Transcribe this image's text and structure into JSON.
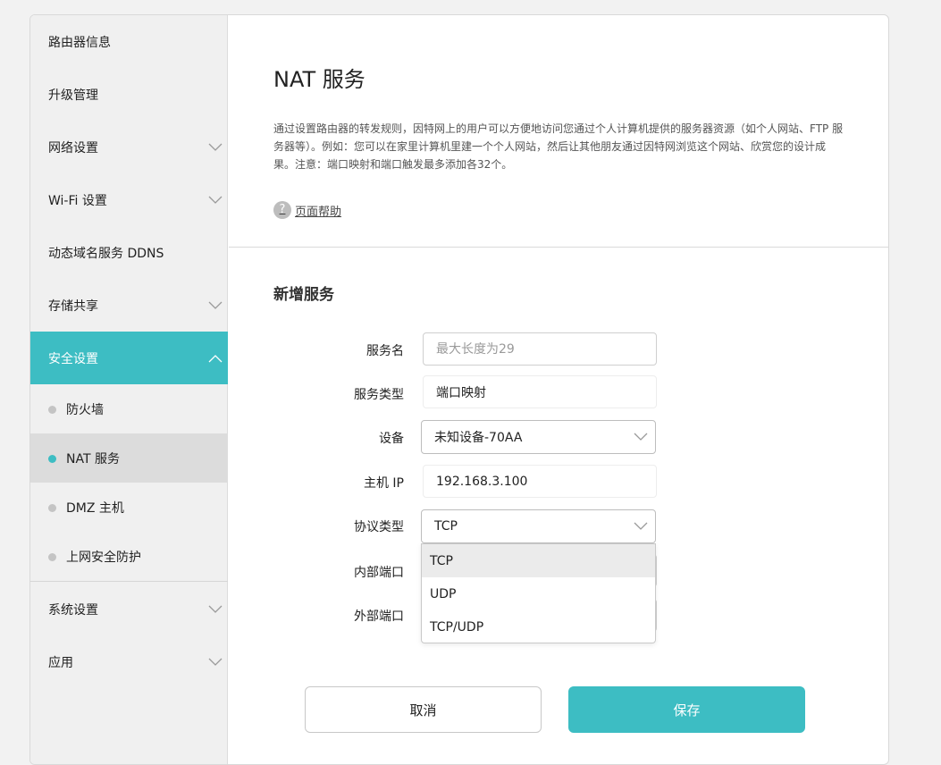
{
  "sidebar": {
    "items": [
      {
        "label": "路由器信息"
      },
      {
        "label": "升级管理"
      },
      {
        "label": "网络设置"
      },
      {
        "label": "Wi-Fi 设置"
      },
      {
        "label": "动态域名服务 DDNS"
      },
      {
        "label": "存储共享"
      },
      {
        "label": "安全设置"
      },
      {
        "label": "系统设置"
      },
      {
        "label": "应用"
      }
    ],
    "security_sub": [
      {
        "label": "防火墙"
      },
      {
        "label": "NAT 服务"
      },
      {
        "label": "DMZ 主机"
      },
      {
        "label": "上网安全防护"
      }
    ],
    "active_item": "安全设置",
    "active_sub": "NAT 服务"
  },
  "main": {
    "title": "NAT 服务",
    "description": "通过设置路由器的转发规则，因特网上的用户可以方便地访问您通过个人计算机提供的服务器资源（如个人网站、FTP 服务器等）。例如：您可以在家里计算机里建一个个人网站，然后让其他朋友通过因特网浏览这个网站、欣赏您的设计成果。注意：端口映射和端口触发最多添加各32个。",
    "help_link": "页面帮助",
    "help_icon": "?",
    "section_title": "新增服务"
  },
  "form": {
    "service_name": {
      "label": "服务名",
      "value": "",
      "placeholder": "最大长度为29"
    },
    "service_type": {
      "label": "服务类型",
      "value": "端口映射"
    },
    "device": {
      "label": "设备",
      "value": "未知设备-70AA"
    },
    "host_ip": {
      "label": "主机 IP",
      "value": "192.168.3.100"
    },
    "protocol": {
      "label": "协议类型",
      "value": "TCP",
      "options": [
        "TCP",
        "UDP",
        "TCP/UDP"
      ]
    },
    "internal_port": {
      "label": "内部端口"
    },
    "external_port": {
      "label": "外部端口"
    }
  },
  "buttons": {
    "cancel": "取消",
    "save": "保存"
  },
  "colors": {
    "accent": "#3dbdc3",
    "sidebar_bg": "#f0f0f0",
    "active_sub_bg": "#dcdcdc"
  }
}
